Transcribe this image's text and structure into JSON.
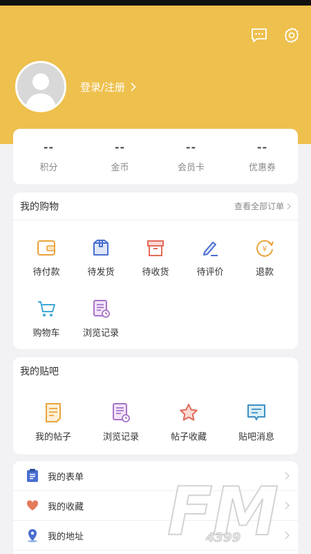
{
  "header": {
    "login_label": "登录/注册",
    "message_icon": "message-icon",
    "settings_icon": "gear-icon"
  },
  "stats": [
    {
      "value": "--",
      "label": "积分"
    },
    {
      "value": "--",
      "label": "金币"
    },
    {
      "value": "--",
      "label": "会员卡"
    },
    {
      "value": "--",
      "label": "优惠券"
    }
  ],
  "shopping": {
    "title": "我的购物",
    "view_all": "查看全部订单",
    "items": [
      {
        "label": "待付款",
        "icon": "wallet-icon"
      },
      {
        "label": "待发货",
        "icon": "package-icon"
      },
      {
        "label": "待收货",
        "icon": "box-icon"
      },
      {
        "label": "待评价",
        "icon": "pen-icon"
      },
      {
        "label": "退款",
        "icon": "refund-icon"
      },
      {
        "label": "购物车",
        "icon": "cart-icon"
      },
      {
        "label": "浏览记录",
        "icon": "history-icon"
      }
    ]
  },
  "tieba": {
    "title": "我的贴吧",
    "items": [
      {
        "label": "我的帖子",
        "icon": "post-icon"
      },
      {
        "label": "浏览记录",
        "icon": "history-icon"
      },
      {
        "label": "帖子收藏",
        "icon": "star-icon"
      },
      {
        "label": "贴吧消息",
        "icon": "chat-icon"
      }
    ]
  },
  "list": [
    {
      "label": "我的表单",
      "icon": "clipboard-icon"
    },
    {
      "label": "我的收藏",
      "icon": "heart-icon"
    },
    {
      "label": "我的地址",
      "icon": "location-icon"
    }
  ],
  "watermark": {
    "text": "FM",
    "sub": "4399"
  },
  "colors": {
    "header_bg": "#eec04d",
    "page_bg": "#f2f2f4",
    "orange": "#e9a33b",
    "blue": "#4a6fd1",
    "red": "#e06a5a",
    "purple": "#a873c9"
  }
}
